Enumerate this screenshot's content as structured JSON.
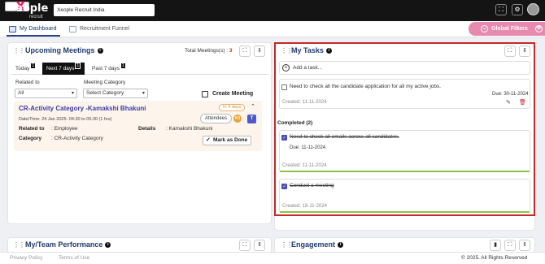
{
  "topbar": {
    "logo_mark": "X",
    "logo_text": "eople",
    "logo_sub": "recruit",
    "org_search_value": "Xeople Recruit India",
    "icons": [
      "fullscreen-icon",
      "settings-gear-icon",
      "avatar"
    ]
  },
  "nav": {
    "tabs": [
      {
        "label": "My Dashboard",
        "active": true
      },
      {
        "label": "Recruitment Funnel",
        "active": false
      }
    ],
    "global_filters": "Global Filters"
  },
  "meetings": {
    "title": "Upcoming Meetings",
    "total_label": "Total Meetings(s) :",
    "total_count": "3",
    "tabs": [
      {
        "label": "Today",
        "badge": "1"
      },
      {
        "label": "Next 7 days",
        "badge": "1"
      },
      {
        "label": "Past 7 days",
        "badge": "1"
      }
    ],
    "related_label": "Related to",
    "related_value": "All",
    "category_label": "Meeting Category",
    "category_value": "Select Category",
    "create_label": "Create Meeting",
    "card": {
      "title": "CR-Activity Category -Kamakshi Bhakuni",
      "badge": "In 4 days",
      "datetime": "Date/Time: 24 Jan 2025- 04:30 to 05:30 (1 hrs)",
      "attendees_label": "Attendees",
      "attendees_count": "KB",
      "related_key": "Related to",
      "related_val": ": Employee",
      "details_key": "Details",
      "details_val": ": Kamakshi Bhakuni",
      "category_key": "Category",
      "category_val": ": CR-Activity Category",
      "mark_done": "Mark as Done"
    }
  },
  "tasks": {
    "title": "My Tasks",
    "add_placeholder": "Add a task...",
    "open": [
      {
        "text": "Need to check all the candidate application for all my active jobs.",
        "due": "Due: 30-11-2024",
        "created": "Created: 11-11-2024"
      }
    ],
    "completed_label": "Completed (2)",
    "completed": [
      {
        "text": "Need to check all emails across all candidates.",
        "due": "Due: 11-11-2024",
        "created": "Created: 11-11-2024"
      },
      {
        "text": "Conduct a meeting",
        "created": "Created: 18-11-2024"
      }
    ]
  },
  "bottom": {
    "performance_title": "My/Team Performance",
    "engagement_title": "Engagement"
  },
  "footer": {
    "privacy": "Privacy Policy",
    "terms": "Terms of Use",
    "copyright": "© 2025. All Rights Reserved"
  },
  "colors": {
    "accent": "#1f3b6e",
    "highlight_border": "#c62828",
    "global_filters": "#e88ab0",
    "complete_bar": "#8bc34a"
  }
}
